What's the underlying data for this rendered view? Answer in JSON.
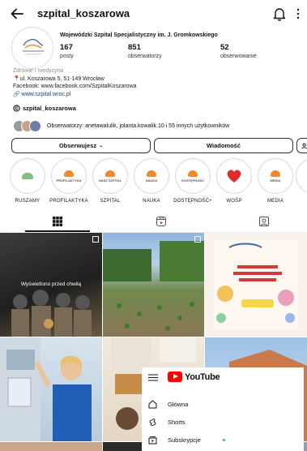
{
  "header": {
    "username": "szpital_koszarowa"
  },
  "profile": {
    "full_name": "Wojewódzki Szpital Specjalistyczny im. J. Gromkowskiego",
    "stats": [
      {
        "value": "167",
        "label": "posty"
      },
      {
        "value": "851",
        "label": "obserwatorzy"
      },
      {
        "value": "52",
        "label": "obserwowanie"
      }
    ],
    "category": "Zdrowie i medycyna",
    "address": "ul. Koszarowa 5, 51-149 Wrocław",
    "facebook": "Facebook: www.facebook.com/SzpitalKoszarowa",
    "website": "www.szpital.wroc.pl",
    "threads_handle": "szpital_koszarowa",
    "followed_by": "Obserwatorzy: anetawalulik, jolanta.kowalik.10 i 55 innych użytkowników"
  },
  "actions": {
    "follow": "Obserwujesz",
    "message": "Wiadomość"
  },
  "highlights": [
    {
      "label": "RUSZAMY",
      "badge": ""
    },
    {
      "label": "PROFILAKTYKA",
      "badge": "PROFILAKTYKA"
    },
    {
      "label": "SZPITAL",
      "badge": "NASZ SZPITAL"
    },
    {
      "label": "NAUKA",
      "badge": "NAUKA"
    },
    {
      "label": "DOSTĘPNOŚĆ+",
      "badge": "DOSTĘPNOŚĆ"
    },
    {
      "label": "WOŚP",
      "badge": ""
    },
    {
      "label": "MEDIA",
      "badge": "MEDIA"
    }
  ],
  "grid": {
    "seen_label": "Wyświetlono przed chwilą"
  },
  "youtube_overlay": {
    "brand": "YouTube",
    "items": [
      "Główna",
      "Shorts",
      "Subskrypcje"
    ]
  },
  "colors": {
    "accent": "#0095f6",
    "highlight_ring": "#d8d8d8",
    "youtube_red": "#ff0000"
  }
}
